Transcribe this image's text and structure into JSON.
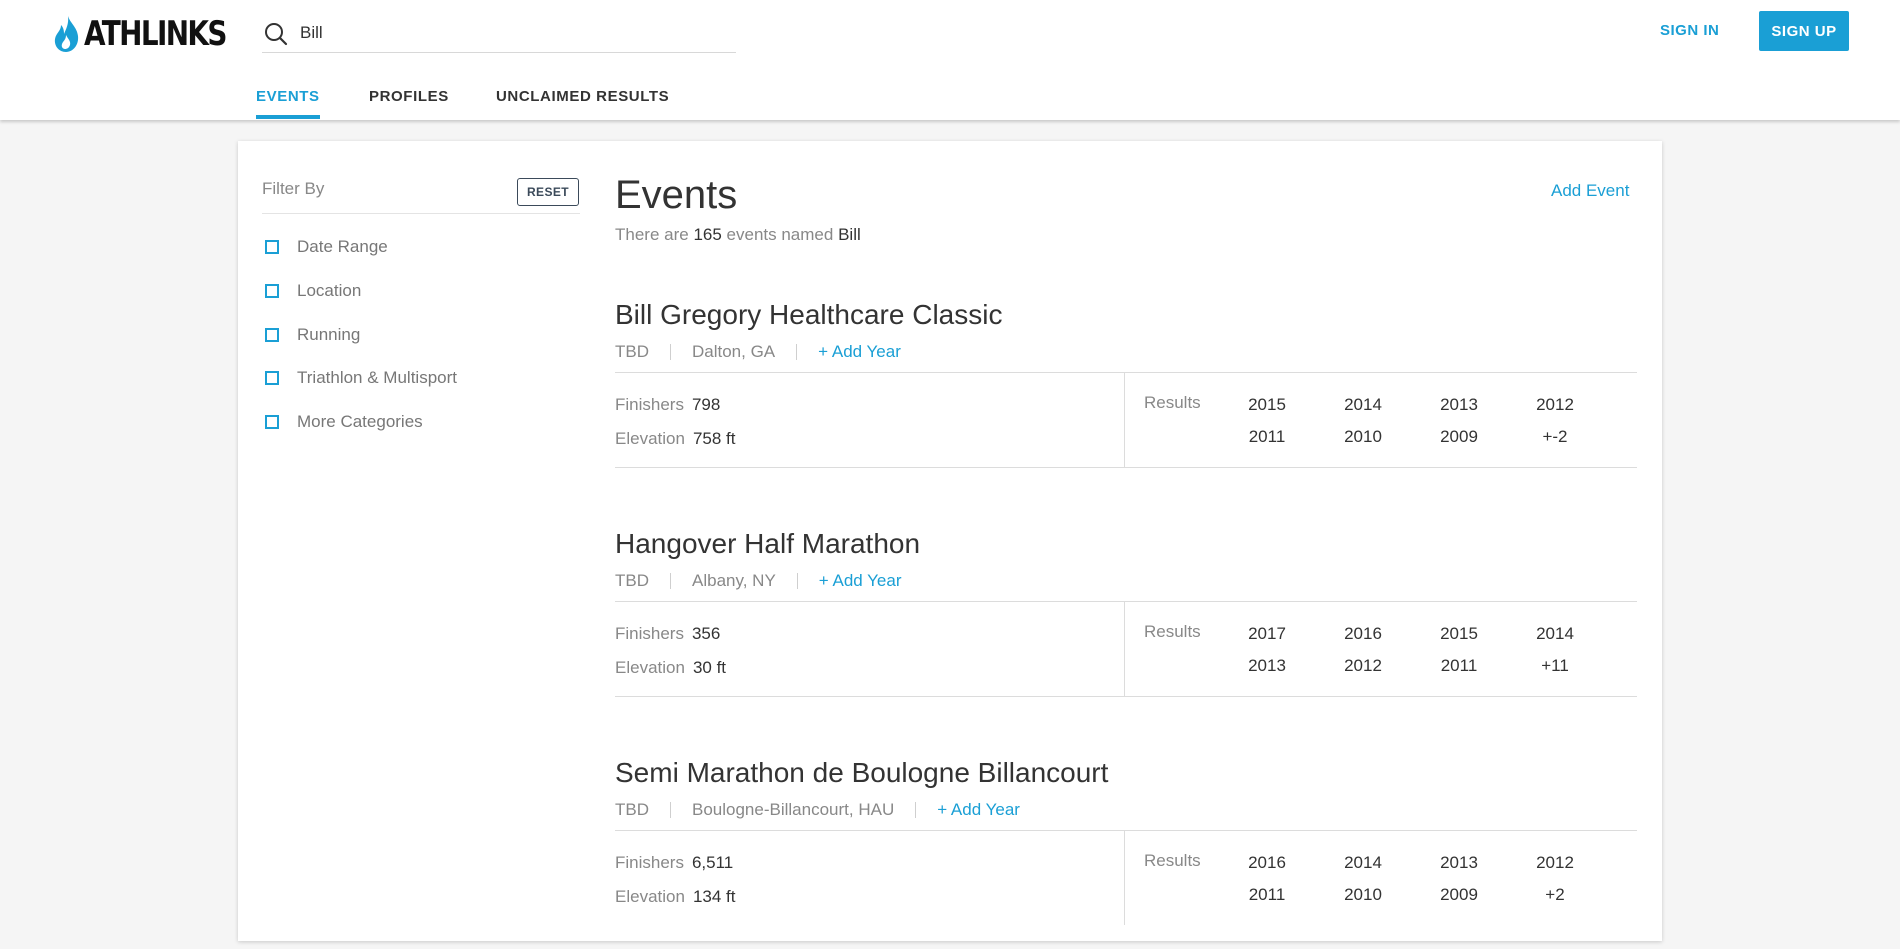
{
  "header": {
    "logo_text": "ATHLINKS",
    "search": {
      "value": "Bill",
      "placeholder": ""
    },
    "sign_in": "SIGN IN",
    "sign_up": "SIGN UP",
    "tabs": [
      {
        "label": "EVENTS",
        "active": true
      },
      {
        "label": "PROFILES",
        "active": false
      },
      {
        "label": "UNCLAIMED RESULTS",
        "active": false
      }
    ]
  },
  "filters": {
    "title": "Filter By",
    "reset": "RESET",
    "items": [
      {
        "label": "Date Range"
      },
      {
        "label": "Location"
      },
      {
        "label": "Running"
      },
      {
        "label": "Triathlon & Multisport"
      },
      {
        "label": "More Categories"
      }
    ]
  },
  "main": {
    "title": "Events",
    "add_event": "Add Event",
    "summary": {
      "prefix": "There are",
      "count": "165",
      "middle": "events named",
      "query": "Bill"
    },
    "finishers_label": "Finishers",
    "elevation_label": "Elevation",
    "results_label": "Results",
    "events": [
      {
        "name": "Bill Gregory Healthcare Classic",
        "date": "TBD",
        "location": "Dalton, GA",
        "add_year": "+ Add Year",
        "finishers": "798",
        "elevation": "758 ft",
        "years": [
          "2015",
          "2014",
          "2013",
          "2012",
          "2011",
          "2010",
          "2009",
          "+-2"
        ]
      },
      {
        "name": "Hangover Half Marathon",
        "date": "TBD",
        "location": "Albany, NY",
        "add_year": "+ Add Year",
        "finishers": "356",
        "elevation": "30 ft",
        "years": [
          "2017",
          "2016",
          "2015",
          "2014",
          "2013",
          "2012",
          "2011",
          "+11"
        ]
      },
      {
        "name": "Semi Marathon de Boulogne Billancourt",
        "date": "TBD",
        "location": "Boulogne-Billancourt, HAU",
        "add_year": "+ Add Year",
        "finishers": "6,511",
        "elevation": "134 ft",
        "years": [
          "2016",
          "2014",
          "2013",
          "2012",
          "2011",
          "2010",
          "2009",
          "+2"
        ]
      }
    ]
  },
  "colors": {
    "accent": "#1a9fd5",
    "text": "#333333",
    "muted": "#888888",
    "background": "#f5f5f5"
  },
  "icons": {
    "logo": "flame-icon",
    "search": "search-icon",
    "checkbox": "checkbox-icon"
  }
}
